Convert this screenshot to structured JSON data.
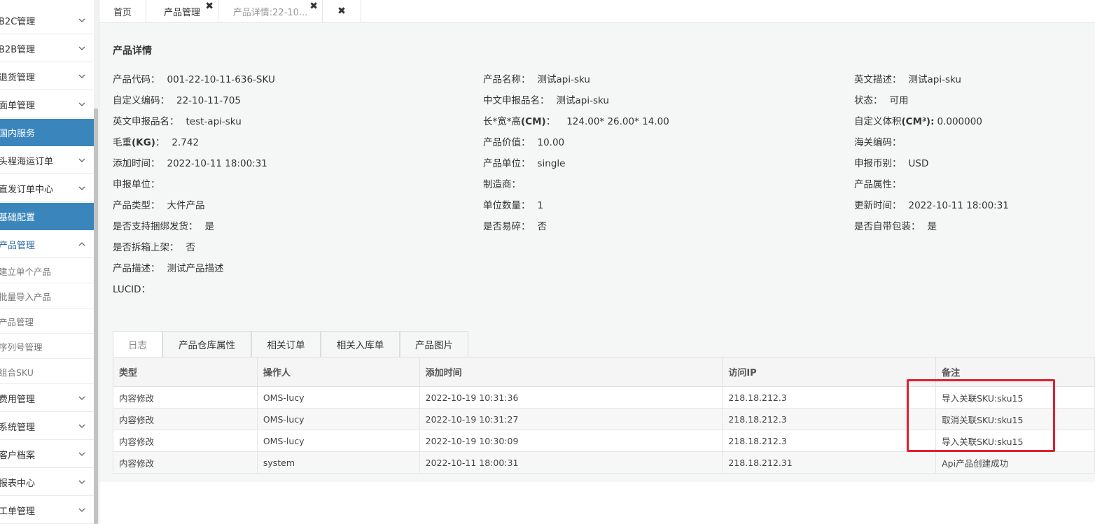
{
  "sidebar": {
    "items": [
      {
        "label": "B2C管理"
      },
      {
        "label": "B2B管理"
      },
      {
        "label": "退货管理"
      },
      {
        "label": "面单管理"
      },
      {
        "label": "国内服务"
      },
      {
        "label": "头程海运订单"
      },
      {
        "label": "直发订单中心"
      },
      {
        "label": "基础配置"
      },
      {
        "label": "产品管理"
      },
      {
        "label": "费用管理"
      },
      {
        "label": "系统管理"
      },
      {
        "label": "客户档案"
      },
      {
        "label": "报表中心"
      },
      {
        "label": "工单管理"
      }
    ],
    "subitems": [
      {
        "label": "建立单个产品"
      },
      {
        "label": "批量导入产品"
      },
      {
        "label": "产品管理"
      },
      {
        "label": "序列号管理"
      },
      {
        "label": "组合SKU"
      }
    ]
  },
  "tabs": [
    {
      "label": "首页"
    },
    {
      "label": "产品管理"
    },
    {
      "label": "产品详情:22-10..."
    }
  ],
  "close_glyph": "✖",
  "page_title": "产品详情",
  "detail": {
    "product_code": {
      "k": "产品代码：",
      "v": "001-22-10-11-636-SKU"
    },
    "custom_code": {
      "k": "自定义编码：",
      "v": "22-10-11-705"
    },
    "en_declare": {
      "k": "英文申报品名：",
      "v": "test-api-sku"
    },
    "gross_weight": {
      "k_pre": "毛重",
      "k_bold": "(KG)",
      "k_post": "：",
      "v": "2.742"
    },
    "add_time": {
      "k": "添加时间：",
      "v": "2022-10-11 18:00:31"
    },
    "declare_unit": {
      "k": "申报单位：",
      "v": ""
    },
    "product_type": {
      "k": "产品类型：",
      "v": "大件产品"
    },
    "bundle_ship": {
      "k": "是否支持捆绑发货：",
      "v": "是"
    },
    "split_shelf": {
      "k": "是否拆箱上架：",
      "v": "否"
    },
    "description": {
      "k": "产品描述：",
      "v": "测试产品描述"
    },
    "lucid": {
      "k": "LUCID：",
      "v": ""
    },
    "product_name": {
      "k": "产品名称：",
      "v": "测试api-sku"
    },
    "cn_declare": {
      "k": "中文申报品名：",
      "v": "测试api-sku"
    },
    "dims": {
      "k_pre": "长*宽*高",
      "k_bold": "(CM)",
      "k_post": "：",
      "v": "124.00* 26.00* 14.00"
    },
    "value": {
      "k": "产品价值：",
      "v": "10.00"
    },
    "unit": {
      "k": "产品单位：",
      "v": "single"
    },
    "manufacturer": {
      "k": "制造商：",
      "v": ""
    },
    "unit_qty": {
      "k": "单位数量：",
      "v": "1"
    },
    "fragile": {
      "k": "是否易碎：",
      "v": "否"
    },
    "en_desc": {
      "k": "英文描述：",
      "v": "测试api-sku"
    },
    "status": {
      "k": "状态：",
      "v": "可用"
    },
    "custom_volume": {
      "k_pre": "自定义体积",
      "k_bold": "(CM³):",
      "k_post": "",
      "v": "0.000000"
    },
    "hs_code": {
      "k": "海关编码：",
      "v": ""
    },
    "currency": {
      "k": "申报币别：",
      "v": "USD"
    },
    "attribute": {
      "k": "产品属性：",
      "v": ""
    },
    "update_time": {
      "k": "更新时间：",
      "v": "2022-10-11 18:00:31"
    },
    "own_packaging": {
      "k": "是否自带包装：",
      "v": "是"
    }
  },
  "detail_tabs": [
    {
      "label": "日志"
    },
    {
      "label": "产品仓库属性"
    },
    {
      "label": "相关订单"
    },
    {
      "label": "相关入库单"
    },
    {
      "label": "产品图片"
    }
  ],
  "log_table": {
    "headers": [
      "类型",
      "操作人",
      "添加时间",
      "访问IP",
      "备注"
    ],
    "rows": [
      [
        "内容修改",
        "OMS-lucy",
        "2022-10-19 10:31:36",
        "218.18.212.3",
        "导入关联SKU:sku15"
      ],
      [
        "内容修改",
        "OMS-lucy",
        "2022-10-19 10:31:27",
        "218.18.212.3",
        "取消关联SKU:sku15"
      ],
      [
        "内容修改",
        "OMS-lucy",
        "2022-10-19 10:30:09",
        "218.18.212.3",
        "导入关联SKU:sku15"
      ],
      [
        "内容修改",
        "system",
        "2022-10-11 18:00:31",
        "218.18.212.31",
        "Api产品创建成功"
      ]
    ]
  },
  "colors": {
    "section_bg": "#3a86bc",
    "highlight_border": "#e0202e",
    "panel_bg": "#f4f7f5"
  }
}
